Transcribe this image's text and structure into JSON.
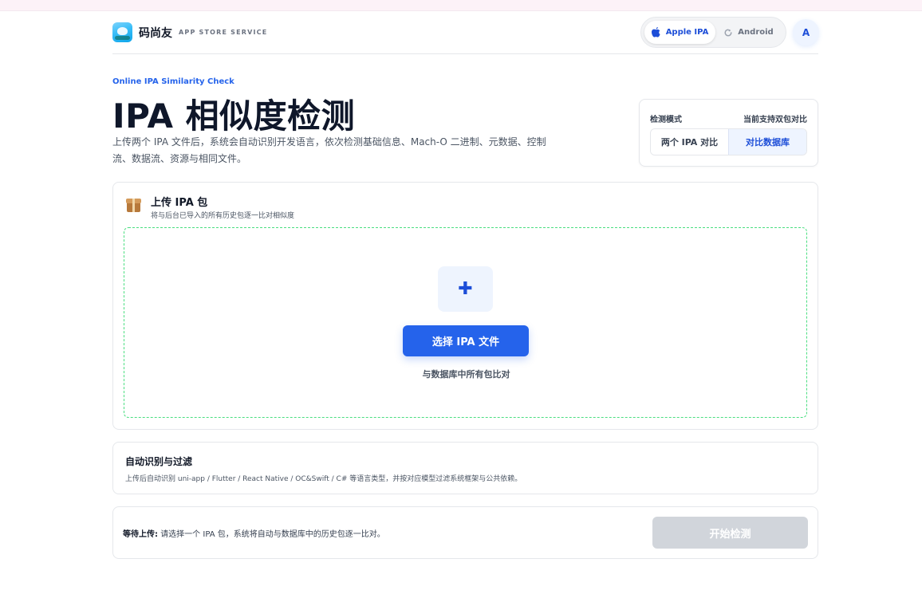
{
  "brand": {
    "name": "码尚友",
    "subtitle": "APP STORE SERVICE"
  },
  "platform_toggle": {
    "options": [
      {
        "label": "Apple IPA",
        "icon": "apple-icon",
        "selected": true
      },
      {
        "label": "Android",
        "icon": "android-icon",
        "selected": false
      }
    ]
  },
  "user": {
    "avatar_initial": "A"
  },
  "hero": {
    "eyebrow": "Online IPA Similarity Check",
    "title": "IPA 相似度检测",
    "description": "上传两个 IPA 文件后，系统会自动识别开发语言，依次检测基础信息、Mach-O 二进制、元数据、控制流、数据流、资源与相同文件。"
  },
  "mode": {
    "label": "检测模式",
    "note": "当前支持双包对比",
    "options": [
      {
        "label": "两个 IPA 对比",
        "selected": false
      },
      {
        "label": "对比数据库",
        "selected": true
      }
    ]
  },
  "upload": {
    "icon": "package-icon",
    "title": "上传 IPA 包",
    "subtitle": "将与后台已导入的所有历史包逐一比对相似度",
    "plus_icon": "plus-icon",
    "plus_glyph": "✚",
    "choose_button": "选择 IPA 文件",
    "hint": "与数据库中所有包比对"
  },
  "filter": {
    "title": "自动识别与过滤",
    "description": "上传后自动识别 uni-app / Flutter / React Native / OC&Swift / C# 等语言类型，并按对应模型过滤系统框架与公共依赖。"
  },
  "action": {
    "status_label": "等待上传:",
    "status_text": "请选择一个 IPA 包，系统将自动与数据库中的历史包逐一比对。",
    "start_button": "开始检测",
    "start_enabled": false
  },
  "colors": {
    "accent": "#2563eb",
    "accent_dark": "#1d4ed8",
    "dropzone_border": "#4ade80",
    "disabled_button": "#d1d5db"
  }
}
